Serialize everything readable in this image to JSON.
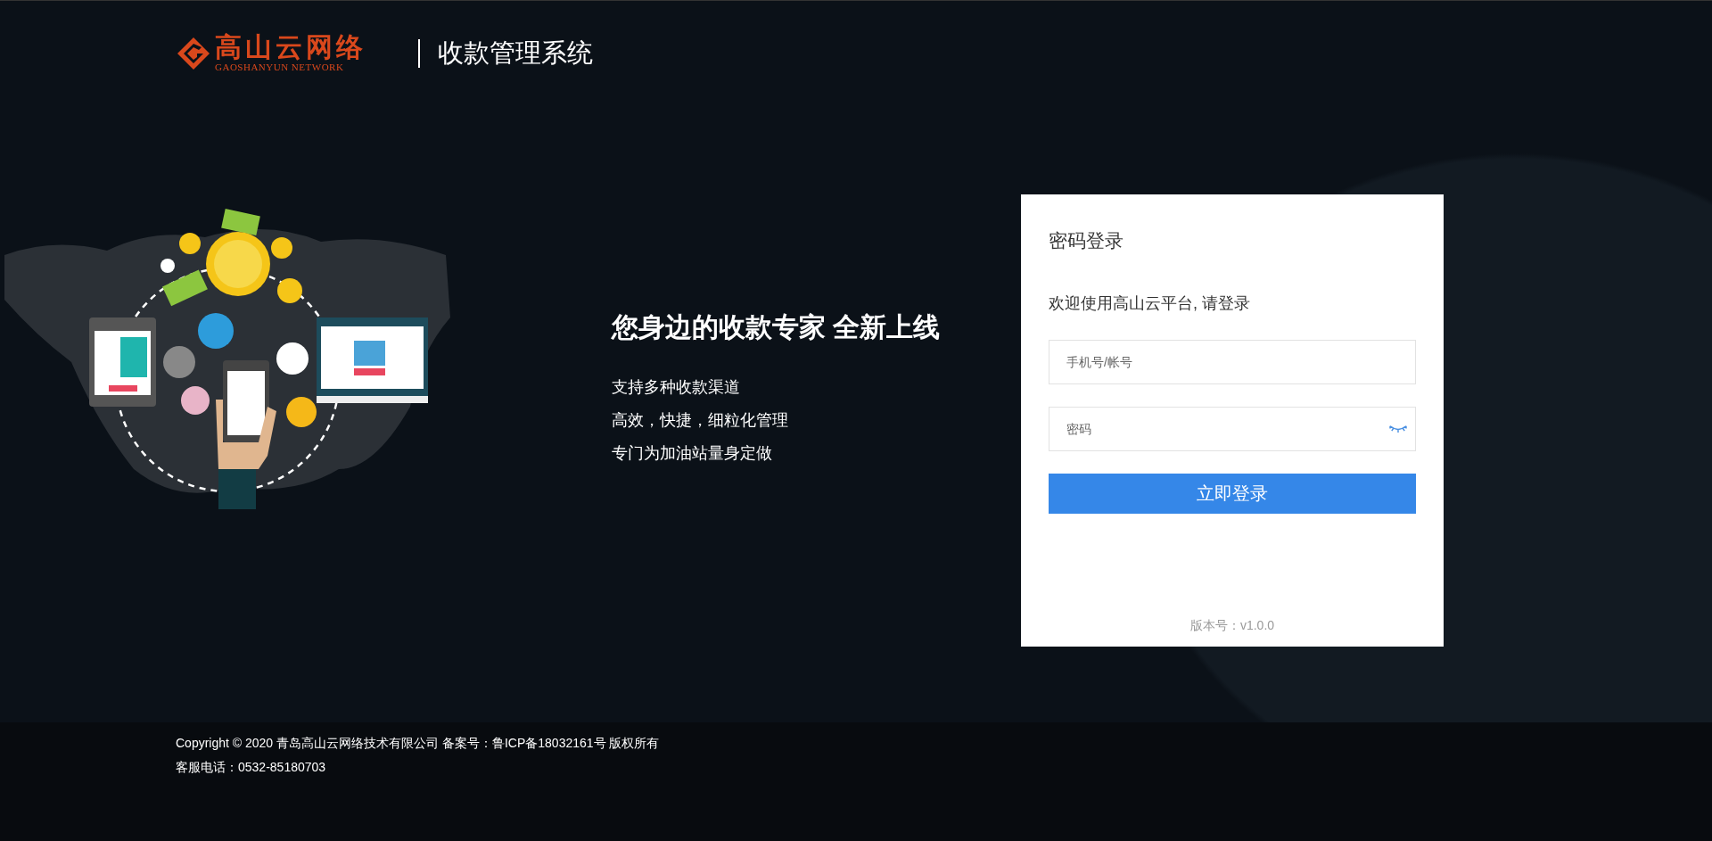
{
  "header": {
    "logo": {
      "name": "高山云网络",
      "subtitle": "GAOSHANYUN NETWORK"
    },
    "title": "收款管理系统"
  },
  "promo": {
    "headline": "您身边的收款专家 全新上线",
    "lines": [
      "支持多种收款渠道",
      "高效，快捷，细粒化管理",
      "专门为加油站量身定做"
    ]
  },
  "login": {
    "title": "密码登录",
    "welcome": "欢迎使用高山云平台, 请登录",
    "fields": [
      {
        "kind": "text",
        "placeholder": "手机号/帐号"
      },
      {
        "kind": "password",
        "placeholder": "密码"
      }
    ],
    "submit": "立即登录",
    "version": "版本号：v1.0.0"
  },
  "footer": {
    "lines": [
      "Copyright © 2020 青岛高山云网络技术有限公司 备案号：鲁ICP备18032161号 版权所有",
      "客服电话：0532-85180703"
    ]
  }
}
